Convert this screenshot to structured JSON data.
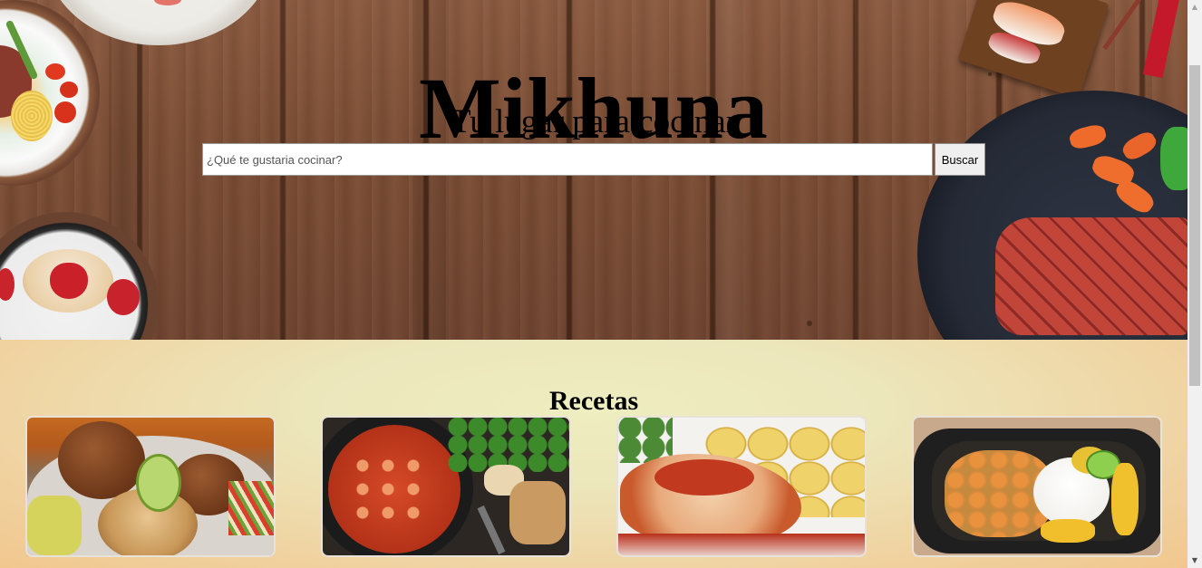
{
  "site": {
    "title": "Mikhuna",
    "subtitle": "Tu lugar para cocinar"
  },
  "search": {
    "placeholder": "¿Qué te gustaria cocinar?",
    "value": "",
    "button_label": "Buscar"
  },
  "recipes": {
    "heading": "Recetas",
    "cards": [
      {
        "image": "papa-rellena-photo"
      },
      {
        "image": "shrimp-stew-photo"
      },
      {
        "image": "fish-with-potatoes-photo"
      },
      {
        "image": "shrimp-rice-skillet-photo"
      }
    ]
  },
  "scrollbar": {
    "up_icon": "▲",
    "down_icon": "▼"
  }
}
